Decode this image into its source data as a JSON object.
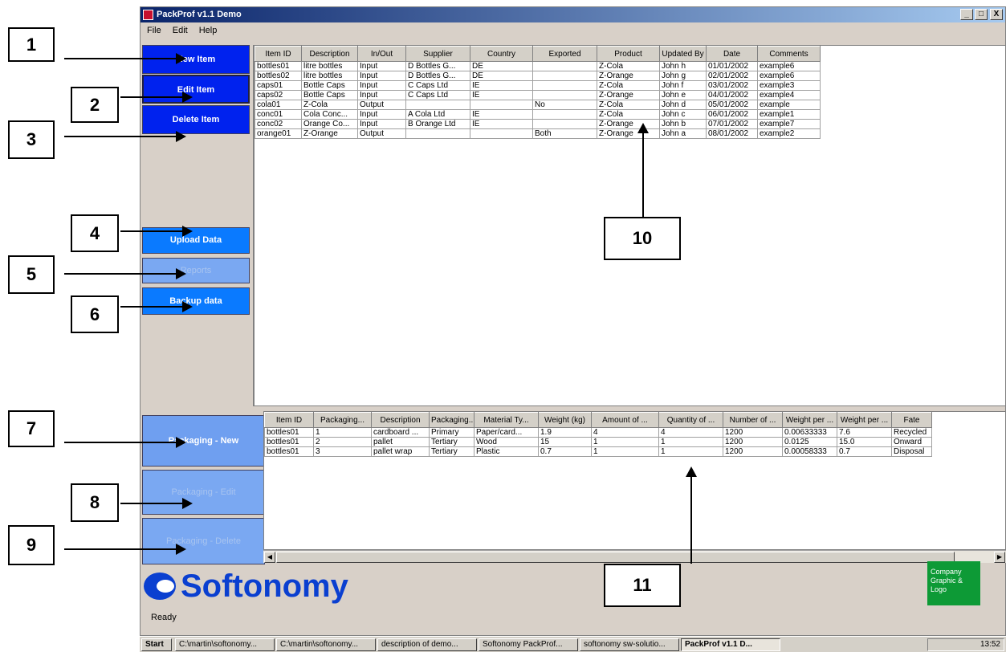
{
  "window": {
    "title": "PackProf v1.1 Demo",
    "controls": [
      "_",
      "□",
      "X"
    ]
  },
  "menu": [
    "File",
    "Edit",
    "Help"
  ],
  "sidebar_top": [
    {
      "label": "New Item",
      "style": "dark"
    },
    {
      "label": "Edit Item",
      "style": "dark"
    },
    {
      "label": "Delete Item",
      "style": "dark"
    }
  ],
  "sidebar_mid": [
    {
      "label": "Upload Data",
      "style": "mid"
    },
    {
      "label": "Reports",
      "style": "disabled"
    },
    {
      "label": "Backup data",
      "style": "mid"
    }
  ],
  "sidebar_bottom": [
    {
      "label": "Packaging - New",
      "style": "light"
    },
    {
      "label": "Packaging - Edit",
      "style": "disabled"
    },
    {
      "label": "Packaging - Delete",
      "style": "disabled"
    }
  ],
  "items_table": {
    "columns": [
      "Item ID",
      "Description",
      "In/Out",
      "Supplier",
      "Country",
      "Exported",
      "Product",
      "Updated By",
      "Date",
      "Comments"
    ],
    "rows": [
      [
        "bottles01",
        "litre bottles",
        "Input",
        "D Bottles G...",
        "DE",
        "",
        "Z-Cola",
        "John h",
        "01/01/2002",
        "example6"
      ],
      [
        "bottles02",
        "litre bottles",
        "Input",
        "D Bottles G...",
        "DE",
        "",
        "Z-Orange",
        "John g",
        "02/01/2002",
        "example6"
      ],
      [
        "caps01",
        "Bottle Caps",
        "Input",
        "C Caps Ltd",
        "IE",
        "",
        "Z-Cola",
        "John f",
        "03/01/2002",
        "example3"
      ],
      [
        "caps02",
        "Bottle Caps",
        "Input",
        "C Caps Ltd",
        "IE",
        "",
        "Z-Orange",
        "John e",
        "04/01/2002",
        "example4"
      ],
      [
        "cola01",
        "Z-Cola",
        "Output",
        "",
        "",
        "No",
        "Z-Cola",
        "John d",
        "05/01/2002",
        "example"
      ],
      [
        "conc01",
        "Cola Conc...",
        "Input",
        "A Cola Ltd",
        "IE",
        "",
        "Z-Cola",
        "John c",
        "06/01/2002",
        "example1"
      ],
      [
        "conc02",
        "Orange Co...",
        "Input",
        "B Orange Ltd",
        "IE",
        "",
        "Z-Orange",
        "John b",
        "07/01/2002",
        "example7"
      ],
      [
        "orange01",
        "Z-Orange",
        "Output",
        "",
        "",
        "Both",
        "Z-Orange",
        "John a",
        "08/01/2002",
        "example2"
      ]
    ]
  },
  "packaging_table": {
    "columns": [
      "Item ID",
      "Packaging...",
      "Description",
      "Packaging...",
      "Material Ty...",
      "Weight (kg)",
      "Amount of ...",
      "Quantity of ...",
      "Number of ...",
      "Weight per ...",
      "Weight per ...",
      "Fate"
    ],
    "rows": [
      [
        "bottles01",
        "1",
        "cardboard ...",
        "Primary",
        "Paper/card...",
        "1.9",
        "4",
        "4",
        "1200",
        "0.00633333",
        "7.6",
        "Recycled"
      ],
      [
        "bottles01",
        "2",
        "pallet",
        "Tertiary",
        "Wood",
        "15",
        "1",
        "1",
        "1200",
        "0.0125",
        "15.0",
        "Onward"
      ],
      [
        "bottles01",
        "3",
        "pallet wrap",
        "Tertiary",
        "Plastic",
        "0.7",
        "1",
        "1",
        "1200",
        "0.00058333",
        "0.7",
        "Disposal"
      ]
    ]
  },
  "logo": {
    "text": "Softonomy"
  },
  "graphic_box": {
    "text": "Company Graphic & Logo"
  },
  "status": "Ready",
  "taskbar": {
    "start": "Start",
    "items": [
      "C:\\martin\\softonomy...",
      "C:\\martin\\softonomy...",
      "description of demo...",
      "Softonomy PackProf...",
      "softonomy sw-solutio...",
      "PackProf v1.1 D..."
    ],
    "clock": "13:52"
  },
  "callouts": [
    "1",
    "2",
    "3",
    "4",
    "5",
    "6",
    "7",
    "8",
    "9",
    "10",
    "11"
  ]
}
